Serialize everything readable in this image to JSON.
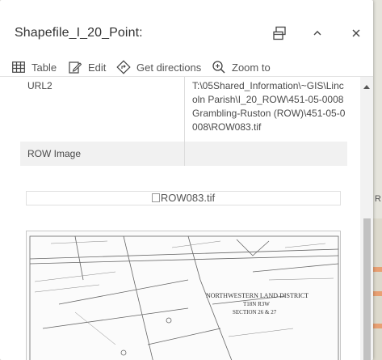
{
  "popup": {
    "title": "Shapefile_I_20_Point:",
    "dock_icon": "dock-icon",
    "collapse_icon": "chevron-up-icon",
    "close_icon": "close-icon"
  },
  "actions": [
    {
      "label": "Table",
      "icon": "table-icon"
    },
    {
      "label": "Edit",
      "icon": "edit-icon"
    },
    {
      "label": "Get directions",
      "icon": "directions-icon"
    },
    {
      "label": "Zoom to",
      "icon": "zoom-to-icon"
    }
  ],
  "attributes": [
    {
      "key": "URL2",
      "value": "T:\\05Shared_Information\\~GIS\\Lincoln Parish\\I_20_ROW\\451-05-0008 Grambling-Ruston (ROW)\\451-05-0008\\ROW083.tif"
    },
    {
      "key": "ROW Image",
      "value": ""
    }
  ],
  "image": {
    "alt": "ROW083.tif",
    "drawing_text": {
      "district": "NORTHWESTERN LAND DISTRICT",
      "township": "T18N R3W",
      "section": "SECTION 26 & 27"
    }
  },
  "map": {
    "edge_label": "R"
  },
  "colors": {
    "accent": "#007ac2",
    "text": "#323232",
    "row_alt": "#f1f1f1",
    "map_bg": "#e5e4dc",
    "map_strip": "#e8a073"
  }
}
